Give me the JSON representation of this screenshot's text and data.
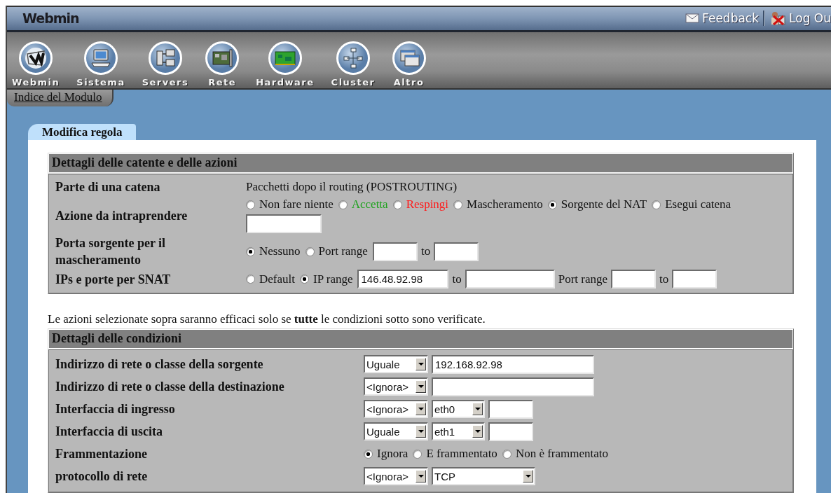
{
  "topbar": {
    "logo": "Webmin",
    "links": [
      {
        "kind": "feedback",
        "label": "Feedback"
      },
      {
        "kind": "logout",
        "label": "Log Ou"
      }
    ]
  },
  "categories": [
    {
      "kind": "web",
      "label": "Webmin"
    },
    {
      "kind": "computer",
      "label": "Sistema"
    },
    {
      "kind": "servers",
      "label": "Servers"
    },
    {
      "kind": "card",
      "label": "Rete"
    },
    {
      "kind": "board",
      "label": "Hardware"
    },
    {
      "kind": "network",
      "label": "Cluster"
    },
    {
      "kind": "windows",
      "label": "Altro"
    }
  ],
  "module_index": "Indice del Modulo",
  "tabs": [
    {
      "label": "Modifica regola",
      "selected": true
    }
  ],
  "panel": [
    {
      "kind": "section",
      "title": "Dettagli delle catente e delle azioni",
      "rows": [
        {
          "label": "Parte di una catena",
          "controls": [
            {
              "kind": "text",
              "text": "Pacchetti dopo il routing (POSTROUTING)"
            }
          ]
        },
        {
          "label": "Azione da intraprendere",
          "controls": [
            {
              "kind": "radio",
              "label": "Non fare niente",
              "selected": false
            },
            {
              "kind": "radio",
              "label": "Accetta",
              "selected": false,
              "color": "#1fa31f"
            },
            {
              "kind": "radio",
              "label": "Respingi",
              "selected": false,
              "color": "#ff1a1a"
            },
            {
              "kind": "radio",
              "label": "Mascheramento",
              "selected": false
            },
            {
              "kind": "radio",
              "label": "Sorgente del NAT",
              "selected": true
            },
            {
              "kind": "radio",
              "label": "Esegui catena",
              "selected": false
            },
            {
              "kind": "field"
            }
          ]
        },
        {
          "label": "Porta sorgente per il mascheramento",
          "controls": [
            {
              "kind": "radio",
              "label": "Nessuno",
              "selected": true
            },
            {
              "kind": "radio",
              "label": "Port range",
              "selected": false
            },
            {
              "kind": "field"
            },
            {
              "kind": "text",
              "text": "to"
            },
            {
              "kind": "field"
            }
          ]
        },
        {
          "label": "IPs e porte per SNAT",
          "controls": [
            {
              "kind": "radio",
              "label": "Default",
              "selected": false
            },
            {
              "kind": "radio",
              "label": "IP range",
              "selected": true
            },
            {
              "kind": "field",
              "value": "146.48.92.98"
            },
            {
              "kind": "text",
              "text": "to"
            },
            {
              "kind": "field"
            },
            {
              "kind": "text",
              "text": "Port range"
            },
            {
              "kind": "field"
            },
            {
              "kind": "text",
              "text": "to"
            },
            {
              "kind": "field"
            }
          ]
        }
      ]
    },
    {
      "kind": "note",
      "text": "Le azioni selezionate sopra saranno efficaci solo se **tutte** le condizioni sotto sono verificate."
    },
    {
      "kind": "section",
      "title": "Dettagli delle condizioni",
      "rows": [
        {
          "label": "Indirizzo di rete o classe della sorgente",
          "controls": [
            {
              "kind": "select",
              "value": "Uguale"
            },
            {
              "kind": "field",
              "value": "192.168.92.98"
            }
          ]
        },
        {
          "label": "Indirizzo di rete o classe della destinazione",
          "controls": [
            {
              "kind": "select",
              "value": "<Ignora>"
            },
            {
              "kind": "field"
            }
          ]
        },
        {
          "label": "Interfaccia di ingresso",
          "controls": [
            {
              "kind": "select",
              "value": "<Ignora>"
            },
            {
              "kind": "select",
              "value": "eth0"
            },
            {
              "kind": "field"
            }
          ]
        },
        {
          "label": "Interfaccia di uscita",
          "controls": [
            {
              "kind": "select",
              "value": "Uguale"
            },
            {
              "kind": "select",
              "value": "eth1"
            },
            {
              "kind": "field"
            }
          ]
        },
        {
          "label": "Frammentazione",
          "controls": [
            {
              "kind": "radio",
              "label": "Ignora",
              "selected": true
            },
            {
              "kind": "radio",
              "label": "E frammentato",
              "selected": false
            },
            {
              "kind": "radio",
              "label": "Non è frammentato",
              "selected": false
            }
          ]
        },
        {
          "label": "protocollo di rete",
          "controls": [
            {
              "kind": "select",
              "value": "<Ignora>"
            },
            {
              "kind": "select",
              "value": "TCP"
            }
          ]
        }
      ]
    }
  ]
}
